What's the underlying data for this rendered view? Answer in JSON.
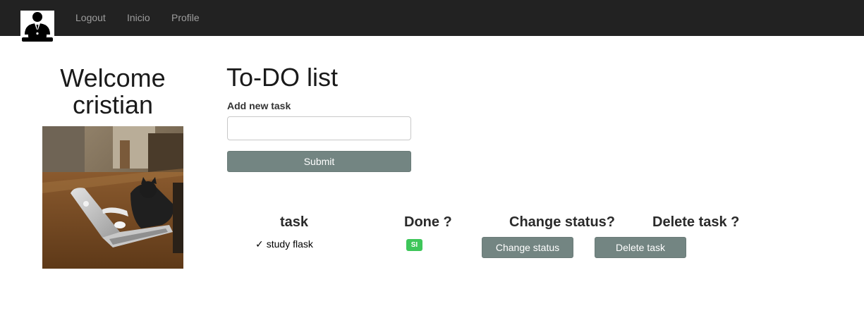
{
  "nav": {
    "logo_icon": "user-at-laptop-icon",
    "links": [
      "Logout",
      "Inicio",
      "Profile"
    ]
  },
  "sidebar": {
    "welcome_line1": "Welcome",
    "welcome_line2": "cristian",
    "photo": "cat-typing-on-laptop-image"
  },
  "main": {
    "title": "To-DO list",
    "form": {
      "label": "Add new task",
      "input_value": "",
      "submit_label": "Submit"
    },
    "table": {
      "headers": [
        "task",
        "Done ?",
        "Change status?",
        "Delete task ?"
      ],
      "rows": [
        {
          "check": "✓",
          "task": "study flask",
          "done_badge": "SI",
          "change_label": "Change status",
          "delete_label": "Delete task"
        }
      ]
    }
  },
  "colors": {
    "navbar": "#222222",
    "button": "#738582",
    "badge_done": "#3ec65a"
  }
}
